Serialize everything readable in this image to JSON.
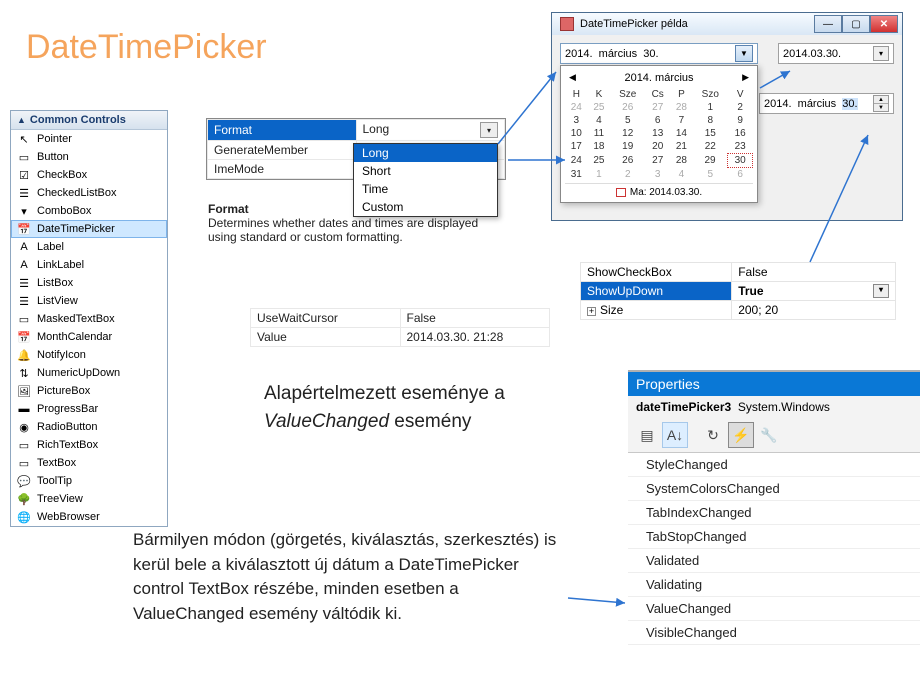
{
  "title": "DateTimePicker",
  "toolbox": {
    "header": "Common Controls",
    "items": [
      "Pointer",
      "Button",
      "CheckBox",
      "CheckedListBox",
      "ComboBox",
      "DateTimePicker",
      "Label",
      "LinkLabel",
      "ListBox",
      "ListView",
      "MaskedTextBox",
      "MonthCalendar",
      "NotifyIcon",
      "NumericUpDown",
      "PictureBox",
      "ProgressBar",
      "RadioButton",
      "RichTextBox",
      "TextBox",
      "ToolTip",
      "TreeView",
      "WebBrowser"
    ],
    "selected_index": 5
  },
  "format_grid": {
    "rows": [
      {
        "name": "Format",
        "value": "Long",
        "selected": true
      },
      {
        "name": "GenerateMember",
        "value": ""
      },
      {
        "name": "ImeMode",
        "value": ""
      }
    ],
    "desc_title": "Format",
    "desc_body": "Determines whether dates and times are displayed using standard or custom formatting."
  },
  "format_dropdown": {
    "items": [
      "Long",
      "Short",
      "Time",
      "Custom"
    ],
    "selected_index": 0
  },
  "value_grid": {
    "rows": [
      {
        "name": "UseWaitCursor",
        "value": "False"
      },
      {
        "name": "Value",
        "value": "2014.03.30. 21:28"
      }
    ]
  },
  "showupdown_grid": {
    "rows": [
      {
        "name": "ShowCheckBox",
        "value": "False"
      },
      {
        "name": "ShowUpDown",
        "value": "True",
        "selected": true,
        "dropdown": true
      },
      {
        "name": "Size",
        "value": "200; 20",
        "expander": true
      }
    ]
  },
  "window": {
    "title": "DateTimePicker példa",
    "long_value_year": "2014.",
    "long_value_month": "március",
    "long_value_day": "30.",
    "short_value": "2014.03.30.",
    "updown_year": "2014.",
    "updown_month": "március",
    "updown_day": "30.",
    "calendar": {
      "header": "2014. március",
      "dow": [
        "H",
        "K",
        "Sze",
        "Cs",
        "P",
        "Szo",
        "V"
      ],
      "weeks": [
        [
          {
            "d": "24",
            "dim": true
          },
          {
            "d": "25",
            "dim": true
          },
          {
            "d": "26",
            "dim": true
          },
          {
            "d": "27",
            "dim": true
          },
          {
            "d": "28",
            "dim": true
          },
          {
            "d": "1"
          },
          {
            "d": "2"
          }
        ],
        [
          {
            "d": "3"
          },
          {
            "d": "4"
          },
          {
            "d": "5"
          },
          {
            "d": "6"
          },
          {
            "d": "7"
          },
          {
            "d": "8"
          },
          {
            "d": "9"
          }
        ],
        [
          {
            "d": "10"
          },
          {
            "d": "11"
          },
          {
            "d": "12"
          },
          {
            "d": "13"
          },
          {
            "d": "14"
          },
          {
            "d": "15"
          },
          {
            "d": "16"
          }
        ],
        [
          {
            "d": "17"
          },
          {
            "d": "18"
          },
          {
            "d": "19"
          },
          {
            "d": "20"
          },
          {
            "d": "21"
          },
          {
            "d": "22"
          },
          {
            "d": "23"
          }
        ],
        [
          {
            "d": "24"
          },
          {
            "d": "25"
          },
          {
            "d": "26"
          },
          {
            "d": "27"
          },
          {
            "d": "28"
          },
          {
            "d": "29"
          },
          {
            "d": "30",
            "today": true
          }
        ],
        [
          {
            "d": "31"
          },
          {
            "d": "1",
            "dim": true
          },
          {
            "d": "2",
            "dim": true
          },
          {
            "d": "3",
            "dim": true
          },
          {
            "d": "4",
            "dim": true
          },
          {
            "d": "5",
            "dim": true
          },
          {
            "d": "6",
            "dim": true
          }
        ]
      ],
      "footer": "Ma: 2014.03.30."
    }
  },
  "paragraph1_a": "Alapértelmezett eseménye a ",
  "paragraph1_b": "ValueChanged",
  "paragraph1_c": " esemény",
  "paragraph2": "Bármilyen módon (görgetés, kiválasztás, szerkesztés) is kerül bele a kiválasztott új dátum a DateTimePicker control TextBox részébe, minden esetben a ValueChanged esemény váltódik ki.",
  "props_panel": {
    "title": "Properties",
    "subtitle_obj": "dateTimePicker3",
    "subtitle_type": "System.Windows",
    "events": [
      "StyleChanged",
      "SystemColorsChanged",
      "TabIndexChanged",
      "TabStopChanged",
      "Validated",
      "Validating",
      "ValueChanged",
      "VisibleChanged"
    ]
  }
}
